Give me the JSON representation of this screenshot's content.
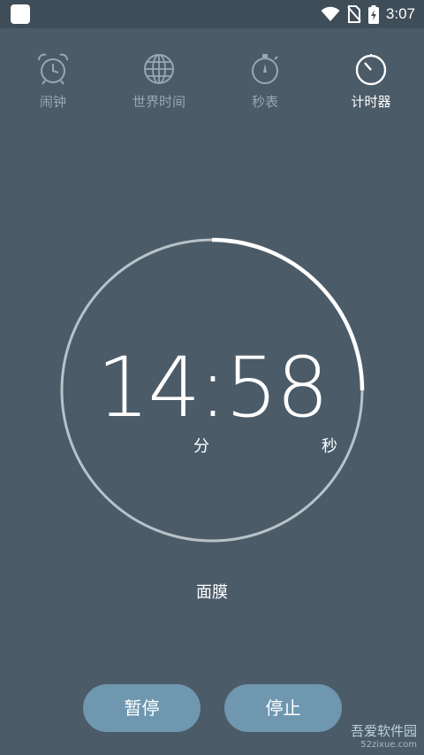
{
  "status_bar": {
    "time": "3:07"
  },
  "tabs": [
    {
      "label": "闹钟",
      "icon": "alarm-clock-icon",
      "active": false
    },
    {
      "label": "世界时间",
      "icon": "globe-icon",
      "active": false
    },
    {
      "label": "秒表",
      "icon": "stopwatch-icon",
      "active": false
    },
    {
      "label": "计时器",
      "icon": "timer-icon",
      "active": true
    }
  ],
  "timer": {
    "time": "14:58",
    "unit_minutes": "分",
    "unit_seconds": "秒",
    "label": "面膜",
    "remaining_fraction": 0.25
  },
  "buttons": {
    "pause_label": "暂停",
    "stop_label": "停止"
  },
  "watermark": {
    "text": "吾爱软件园",
    "url": "52zixue.com"
  },
  "colors": {
    "background": "#4b5b68",
    "status_bar": "#3f4d58",
    "ring_track": "#b8c2c8",
    "ring_progress": "#ffffff",
    "button": "#6f97b0",
    "tab_inactive": "#9aa7b1"
  }
}
